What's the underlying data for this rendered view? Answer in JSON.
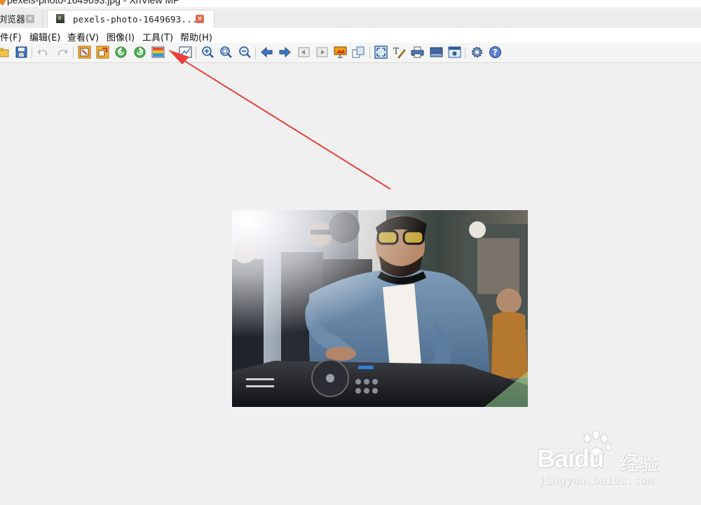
{
  "window": {
    "title": "pexels-photo-1649693.jpg - XnView MP"
  },
  "tabs": [
    {
      "label": "浏览器",
      "close": "×",
      "active": false
    },
    {
      "label": "pexels-photo-1649693...",
      "close": "×",
      "active": true
    }
  ],
  "menu": [
    {
      "label": "文件(F)"
    },
    {
      "label": "编辑(E)"
    },
    {
      "label": "查看(V)"
    },
    {
      "label": "图像(I)"
    },
    {
      "label": "工具(T)"
    },
    {
      "label": "帮助(H)"
    }
  ],
  "toolbar": {
    "icons": [
      "open-folder-icon",
      "save-icon",
      "undo-icon",
      "redo-icon",
      "crop-icon",
      "resize-icon",
      "rotate-left-icon",
      "rotate-right-icon",
      "adjust-icon",
      "compare-icon",
      "zoom-in-icon",
      "zoom-fit-icon",
      "zoom-out-icon",
      "previous-icon",
      "next-icon",
      "first-icon",
      "last-icon",
      "slideshow-icon",
      "copy-icon",
      "fullscreen-icon",
      "edit-text-icon",
      "print-icon",
      "scanner-icon",
      "capture-icon",
      "settings-icon",
      "help-icon"
    ]
  },
  "image": {
    "description_name": "dj-photo"
  },
  "annotation": {
    "color": "#e8413c"
  },
  "watermark": {
    "brand": "Baidu",
    "cn": "经验",
    "url": "jingyan.baidu.com"
  }
}
